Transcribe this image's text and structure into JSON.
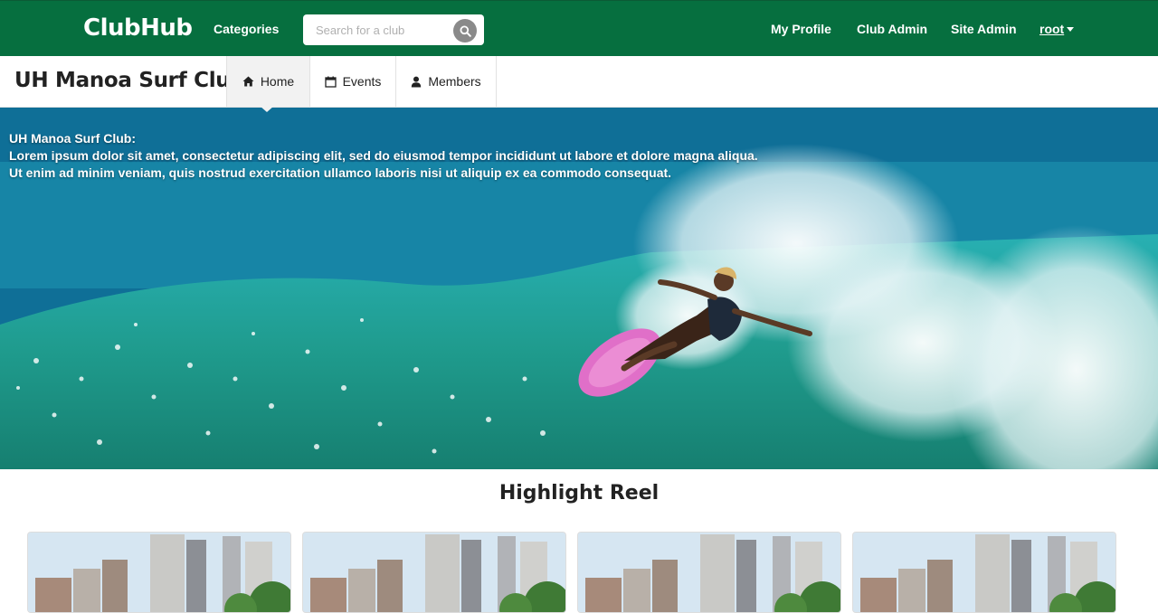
{
  "topnav": {
    "brand": "ClubHub",
    "categories_label": "Categories",
    "search_placeholder": "Search for a club",
    "my_profile_label": "My Profile",
    "club_admin_label": "Club Admin",
    "site_admin_label": "Site Admin",
    "user_label": "root"
  },
  "club": {
    "name": "UH Manoa Surf Club",
    "tabs": [
      {
        "label": "Home",
        "icon": "home-icon",
        "active": true
      },
      {
        "label": "Events",
        "icon": "calendar-icon",
        "active": false
      },
      {
        "label": "Members",
        "icon": "user-icon",
        "active": false
      }
    ]
  },
  "hero": {
    "line1": "UH Manoa Surf Club:",
    "line2": "Lorem ipsum dolor sit amet, consectetur adipiscing elit, sed do eiusmod tempor incididunt ut labore et dolore magna aliqua.",
    "line3": "Ut enim ad minim veniam, quis nostrud exercitation ullamco laboris nisi ut aliquip ex ea commodo consequat."
  },
  "highlight_reel": {
    "title": "Highlight Reel",
    "item_count": 4
  },
  "colors": {
    "navbar": "#066f3f",
    "tab_active": "#f2f2f2"
  }
}
